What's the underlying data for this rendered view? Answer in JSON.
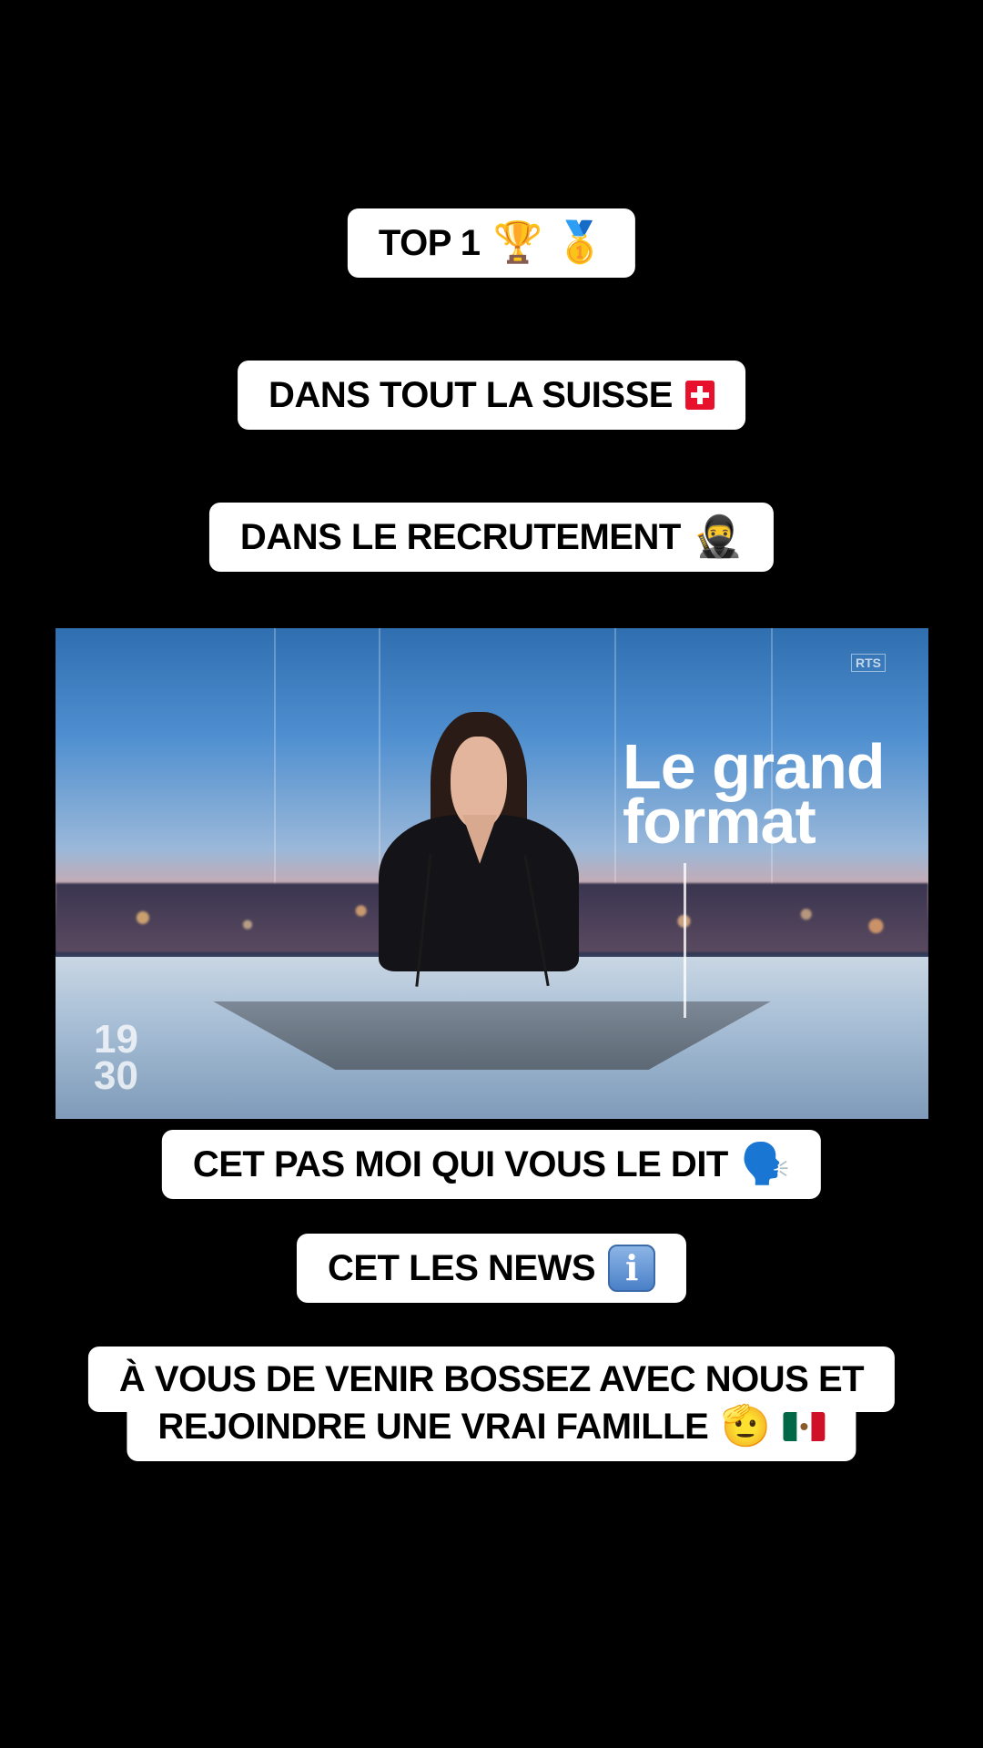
{
  "captions": {
    "top1": "TOP 1",
    "suisse": "DANS TOUT LA SUISSE",
    "recrutement": "DANS LE RECRUTEMENT",
    "moi": "CET PAS MOI QUI VOUS LE DIT",
    "news": "CET LES NEWS",
    "bossez_line1": "À VOUS DE VENIR BOSSEZ AVEC NOUS ET",
    "bossez_line2": "REJOINDRE UNE VRAI FAMILLE"
  },
  "emojis": {
    "trophy": "🏆",
    "medal": "🥇",
    "ninja": "🥷",
    "speaking_head": "🗣️",
    "salute": "🫡"
  },
  "news_image": {
    "channel_logo": "RTS",
    "headline_line1": "Le grand",
    "headline_line2": "format",
    "clock_line1": "19",
    "clock_line2": "30"
  },
  "icons": {
    "swiss_flag": "swiss-flag-icon",
    "mexico_flag": "mexico-flag-icon",
    "info": "information-icon"
  },
  "colors": {
    "background": "#000000",
    "caption_bg": "#ffffff",
    "caption_text": "#000000",
    "swiss_red": "#e8112d"
  }
}
